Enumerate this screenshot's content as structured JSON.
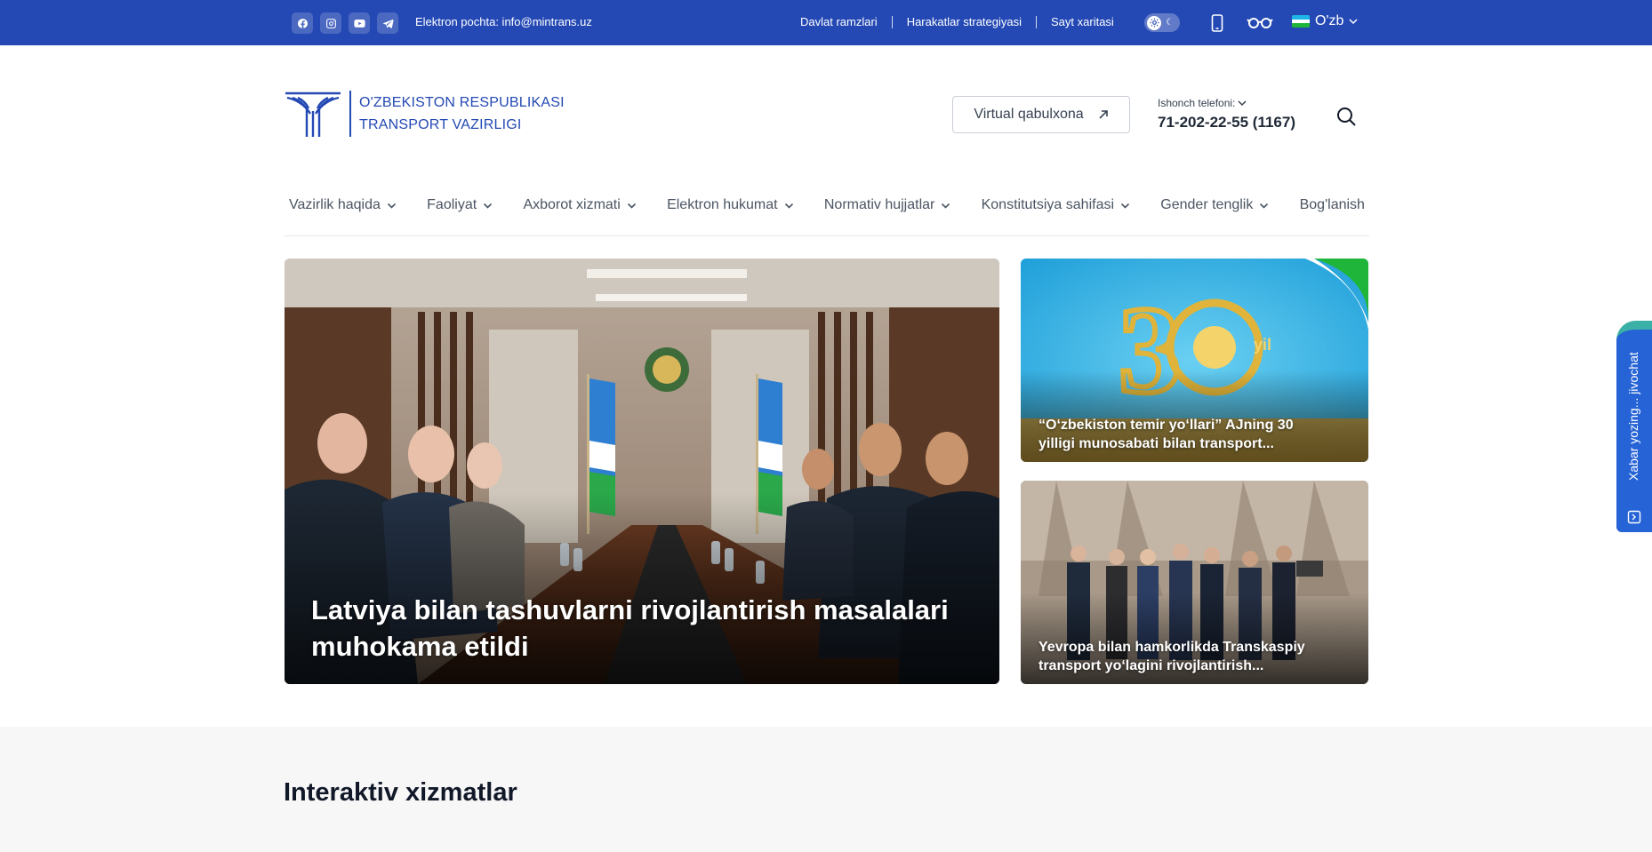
{
  "colors": {
    "brand": "#2449b4",
    "side_tab": "#2563d6",
    "section_bg": "#f7f7f8"
  },
  "topbar": {
    "social_icons": [
      "facebook-icon",
      "instagram-icon",
      "youtube-icon",
      "telegram-icon"
    ],
    "email": "Elektron pochta: info@mintrans.uz",
    "links": [
      "Davlat ramzlari",
      "Harakatlar strategiyasi",
      "Sayt xaritasi"
    ],
    "language": "O'zb"
  },
  "header": {
    "logo_line1": "O'ZBEKISTON RESPUBLIKASI",
    "logo_line2": "TRANSPORT VAZIRLIGI",
    "virtual_button": "Virtual qabulxona",
    "hotline_label": "Ishonch telefoni:",
    "hotline_number": "71-202-22-55 (1167)"
  },
  "nav": {
    "items": [
      "Vazirlik haqida",
      "Faoliyat",
      "Axborot xizmati",
      "Elektron hukumat",
      "Normativ hujjatlar",
      "Konstitutsiya sahifasi",
      "Gender tenglik",
      "Bog'lanish"
    ]
  },
  "hero": {
    "main_title": "Latviya bilan tashuvlarni rivojlantirish masalalari muhokama etildi",
    "side1_title": "“O‘zbekiston temir yo‘llari” AJning 30 yilligi munosabati bilan transport...",
    "side1_banner_text": "yil",
    "side2_title": "Yevropa bilan hamkorlikda Transkaspiy transport yo‘lagini rivojlantirish..."
  },
  "side_tab": {
    "label": "Xabar yozing... jivochat"
  },
  "section": {
    "title": "Interaktiv xizmatlar"
  }
}
